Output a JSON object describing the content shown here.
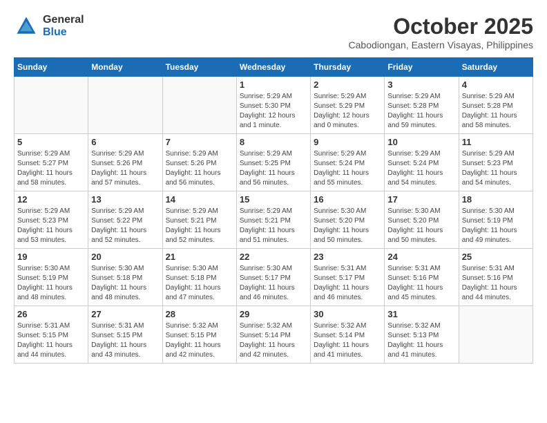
{
  "logo": {
    "general": "General",
    "blue": "Blue"
  },
  "title": {
    "month_year": "October 2025",
    "location": "Cabodiongan, Eastern Visayas, Philippines"
  },
  "headers": [
    "Sunday",
    "Monday",
    "Tuesday",
    "Wednesday",
    "Thursday",
    "Friday",
    "Saturday"
  ],
  "weeks": [
    [
      {
        "day": "",
        "info": ""
      },
      {
        "day": "",
        "info": ""
      },
      {
        "day": "",
        "info": ""
      },
      {
        "day": "1",
        "info": "Sunrise: 5:29 AM\nSunset: 5:30 PM\nDaylight: 12 hours\nand 1 minute."
      },
      {
        "day": "2",
        "info": "Sunrise: 5:29 AM\nSunset: 5:29 PM\nDaylight: 12 hours\nand 0 minutes."
      },
      {
        "day": "3",
        "info": "Sunrise: 5:29 AM\nSunset: 5:28 PM\nDaylight: 11 hours\nand 59 minutes."
      },
      {
        "day": "4",
        "info": "Sunrise: 5:29 AM\nSunset: 5:28 PM\nDaylight: 11 hours\nand 58 minutes."
      }
    ],
    [
      {
        "day": "5",
        "info": "Sunrise: 5:29 AM\nSunset: 5:27 PM\nDaylight: 11 hours\nand 58 minutes."
      },
      {
        "day": "6",
        "info": "Sunrise: 5:29 AM\nSunset: 5:26 PM\nDaylight: 11 hours\nand 57 minutes."
      },
      {
        "day": "7",
        "info": "Sunrise: 5:29 AM\nSunset: 5:26 PM\nDaylight: 11 hours\nand 56 minutes."
      },
      {
        "day": "8",
        "info": "Sunrise: 5:29 AM\nSunset: 5:25 PM\nDaylight: 11 hours\nand 56 minutes."
      },
      {
        "day": "9",
        "info": "Sunrise: 5:29 AM\nSunset: 5:24 PM\nDaylight: 11 hours\nand 55 minutes."
      },
      {
        "day": "10",
        "info": "Sunrise: 5:29 AM\nSunset: 5:24 PM\nDaylight: 11 hours\nand 54 minutes."
      },
      {
        "day": "11",
        "info": "Sunrise: 5:29 AM\nSunset: 5:23 PM\nDaylight: 11 hours\nand 54 minutes."
      }
    ],
    [
      {
        "day": "12",
        "info": "Sunrise: 5:29 AM\nSunset: 5:23 PM\nDaylight: 11 hours\nand 53 minutes."
      },
      {
        "day": "13",
        "info": "Sunrise: 5:29 AM\nSunset: 5:22 PM\nDaylight: 11 hours\nand 52 minutes."
      },
      {
        "day": "14",
        "info": "Sunrise: 5:29 AM\nSunset: 5:21 PM\nDaylight: 11 hours\nand 52 minutes."
      },
      {
        "day": "15",
        "info": "Sunrise: 5:29 AM\nSunset: 5:21 PM\nDaylight: 11 hours\nand 51 minutes."
      },
      {
        "day": "16",
        "info": "Sunrise: 5:30 AM\nSunset: 5:20 PM\nDaylight: 11 hours\nand 50 minutes."
      },
      {
        "day": "17",
        "info": "Sunrise: 5:30 AM\nSunset: 5:20 PM\nDaylight: 11 hours\nand 50 minutes."
      },
      {
        "day": "18",
        "info": "Sunrise: 5:30 AM\nSunset: 5:19 PM\nDaylight: 11 hours\nand 49 minutes."
      }
    ],
    [
      {
        "day": "19",
        "info": "Sunrise: 5:30 AM\nSunset: 5:19 PM\nDaylight: 11 hours\nand 48 minutes."
      },
      {
        "day": "20",
        "info": "Sunrise: 5:30 AM\nSunset: 5:18 PM\nDaylight: 11 hours\nand 48 minutes."
      },
      {
        "day": "21",
        "info": "Sunrise: 5:30 AM\nSunset: 5:18 PM\nDaylight: 11 hours\nand 47 minutes."
      },
      {
        "day": "22",
        "info": "Sunrise: 5:30 AM\nSunset: 5:17 PM\nDaylight: 11 hours\nand 46 minutes."
      },
      {
        "day": "23",
        "info": "Sunrise: 5:31 AM\nSunset: 5:17 PM\nDaylight: 11 hours\nand 46 minutes."
      },
      {
        "day": "24",
        "info": "Sunrise: 5:31 AM\nSunset: 5:16 PM\nDaylight: 11 hours\nand 45 minutes."
      },
      {
        "day": "25",
        "info": "Sunrise: 5:31 AM\nSunset: 5:16 PM\nDaylight: 11 hours\nand 44 minutes."
      }
    ],
    [
      {
        "day": "26",
        "info": "Sunrise: 5:31 AM\nSunset: 5:15 PM\nDaylight: 11 hours\nand 44 minutes."
      },
      {
        "day": "27",
        "info": "Sunrise: 5:31 AM\nSunset: 5:15 PM\nDaylight: 11 hours\nand 43 minutes."
      },
      {
        "day": "28",
        "info": "Sunrise: 5:32 AM\nSunset: 5:15 PM\nDaylight: 11 hours\nand 42 minutes."
      },
      {
        "day": "29",
        "info": "Sunrise: 5:32 AM\nSunset: 5:14 PM\nDaylight: 11 hours\nand 42 minutes."
      },
      {
        "day": "30",
        "info": "Sunrise: 5:32 AM\nSunset: 5:14 PM\nDaylight: 11 hours\nand 41 minutes."
      },
      {
        "day": "31",
        "info": "Sunrise: 5:32 AM\nSunset: 5:13 PM\nDaylight: 11 hours\nand 41 minutes."
      },
      {
        "day": "",
        "info": ""
      }
    ]
  ]
}
